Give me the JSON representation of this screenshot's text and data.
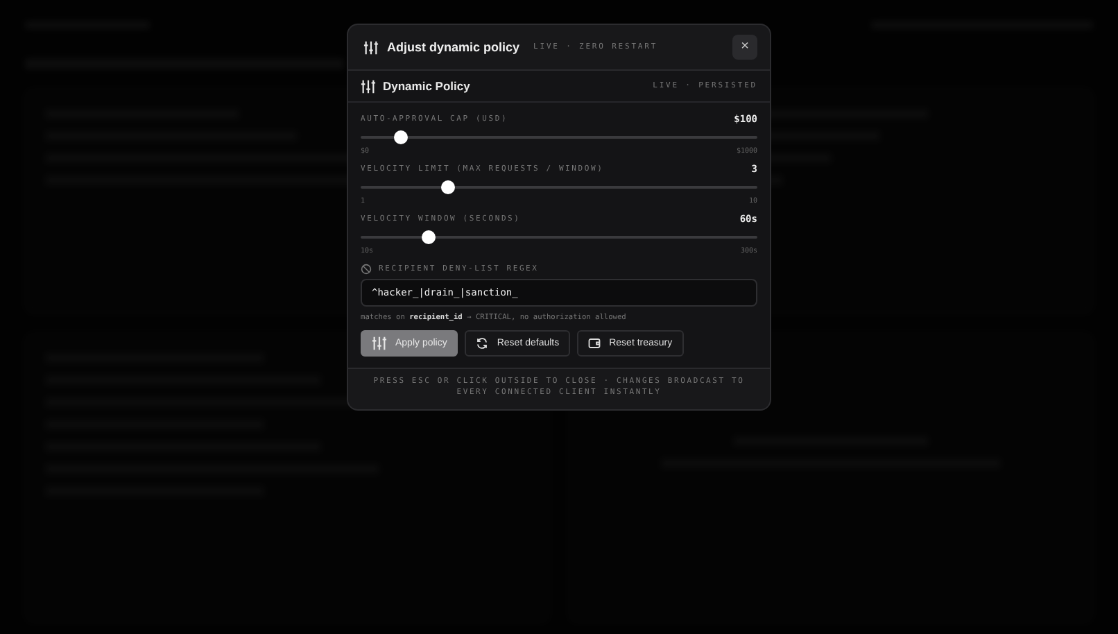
{
  "dialog": {
    "title": "Adjust dynamic policy",
    "subtitle": "LIVE · ZERO RESTART",
    "close": "×",
    "panel": {
      "title": "Dynamic Policy",
      "status": "LIVE · PERSISTED",
      "sliders": [
        {
          "label": "AUTO-APPROVAL CAP (USD)",
          "reading": "$100",
          "level": 0.1,
          "min": "$0",
          "max": "$1000"
        },
        {
          "label": "VELOCITY LIMIT (MAX REQUESTS / WINDOW)",
          "reading": "3",
          "level": 0.22,
          "min": "1",
          "max": "10"
        },
        {
          "label": "VELOCITY WINDOW (SECONDS)",
          "reading": "60s",
          "level": 0.17,
          "min": "10s",
          "max": "300s"
        }
      ],
      "regex": {
        "label": "RECIPIENT DENY-LIST REGEX",
        "value": "^hacker_|drain_|sanction_",
        "hint": "matches on **recipient_id** → CRITICAL, no authorization allowed"
      },
      "buttons": [
        {
          "label": "Apply policy",
          "kind": "primary"
        },
        {
          "label": "Reset defaults",
          "kind": "reset"
        },
        {
          "label": "Reset treasury",
          "kind": "treasury"
        }
      ]
    },
    "footer": "PRESS ESC OR CLICK OUTSIDE TO CLOSE · CHANGES BROADCAST TO EVERY CONNECTED CLIENT INSTANTLY"
  }
}
